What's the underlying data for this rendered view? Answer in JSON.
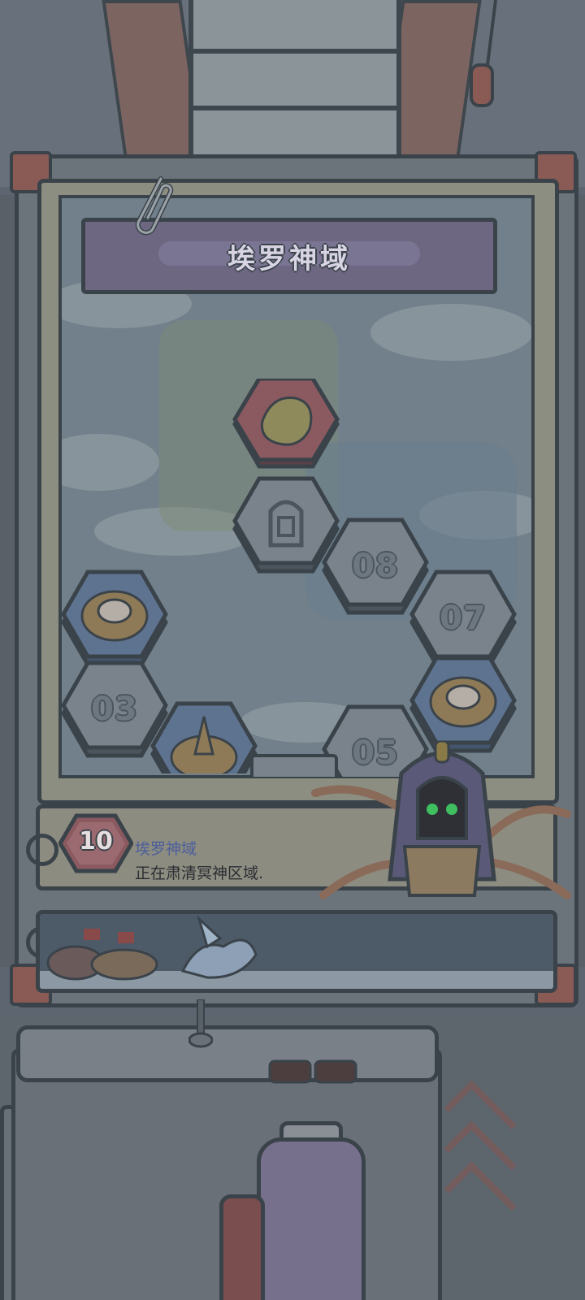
{
  "region": {
    "title": "埃罗神域"
  },
  "map_tiles": [
    {
      "id": "shrine-top",
      "label": "",
      "state": "current",
      "icon": "map-fragment-icon"
    },
    {
      "id": "pharaoh",
      "label": "",
      "state": "locked",
      "icon": "pharaoh-mask-icon"
    },
    {
      "id": "08",
      "label": "08",
      "state": "locked",
      "icon": ""
    },
    {
      "id": "07",
      "label": "07",
      "state": "locked",
      "icon": ""
    },
    {
      "id": "treasure-left",
      "label": "",
      "state": "treasure",
      "icon": "bone-nest-icon"
    },
    {
      "id": "03",
      "label": "03",
      "state": "locked",
      "icon": ""
    },
    {
      "id": "treasure-right",
      "label": "",
      "state": "treasure",
      "icon": "bone-nest-icon"
    },
    {
      "id": "05",
      "label": "05",
      "state": "locked",
      "icon": ""
    },
    {
      "id": "snake-egg",
      "label": "",
      "state": "treasure",
      "icon": "snake-egg-icon"
    }
  ],
  "info": {
    "level": "10",
    "title": "埃罗神域",
    "description": "正在肃清冥神区域."
  },
  "colors": {
    "tile_locked": "#7a838b",
    "tile_current": "#8a5a60",
    "tile_treasure": "#5e7390",
    "info_title": "#4b5e9c",
    "overlay_dim": "#5d6670"
  }
}
